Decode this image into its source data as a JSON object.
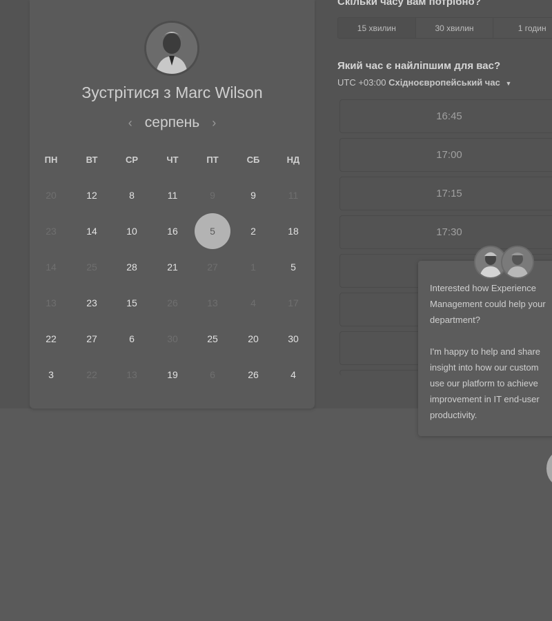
{
  "left": {
    "title": "Зустрітися з Marc Wilson",
    "month": "серпень",
    "prev_icon": "‹",
    "next_icon": "›",
    "weekdays": [
      "ПН",
      "ВТ",
      "СР",
      "ЧТ",
      "ПТ",
      "СБ",
      "НД"
    ],
    "weeks": [
      [
        {
          "t": "20",
          "m": true
        },
        {
          "t": "12",
          "m": false
        },
        {
          "t": "8",
          "m": false
        },
        {
          "t": "11",
          "m": false
        },
        {
          "t": "9",
          "m": true
        },
        {
          "t": "9",
          "m": false
        },
        {
          "t": "11",
          "m": true
        }
      ],
      [
        {
          "t": "23",
          "m": true
        },
        {
          "t": "14",
          "m": false
        },
        {
          "t": "10",
          "m": false
        },
        {
          "t": "16",
          "m": false
        },
        {
          "t": "5",
          "m": false,
          "s": true
        },
        {
          "t": "2",
          "m": false
        },
        {
          "t": "18",
          "m": false
        }
      ],
      [
        {
          "t": "14",
          "m": true
        },
        {
          "t": "25",
          "m": true
        },
        {
          "t": "28",
          "m": false
        },
        {
          "t": "21",
          "m": false
        },
        {
          "t": "27",
          "m": true
        },
        {
          "t": "1",
          "m": true
        },
        {
          "t": "5",
          "m": false
        }
      ],
      [
        {
          "t": "13",
          "m": true
        },
        {
          "t": "23",
          "m": false
        },
        {
          "t": "15",
          "m": false
        },
        {
          "t": "26",
          "m": true
        },
        {
          "t": "13",
          "m": true
        },
        {
          "t": "4",
          "m": true
        },
        {
          "t": "17",
          "m": true
        }
      ],
      [
        {
          "t": "22",
          "m": false
        },
        {
          "t": "27",
          "m": false
        },
        {
          "t": "6",
          "m": false
        },
        {
          "t": "30",
          "m": true
        },
        {
          "t": "25",
          "m": false
        },
        {
          "t": "20",
          "m": false
        },
        {
          "t": "30",
          "m": false
        }
      ],
      [
        {
          "t": "3",
          "m": false
        },
        {
          "t": "22",
          "m": true
        },
        {
          "t": "13",
          "m": true
        },
        {
          "t": "19",
          "m": false
        },
        {
          "t": "6",
          "m": true
        },
        {
          "t": "26",
          "m": false
        },
        {
          "t": "4",
          "m": false
        }
      ]
    ]
  },
  "right": {
    "duration_question": "Скільки часу вам потрібно?",
    "durations": [
      "15 хвилин",
      "30 хвилин",
      "1 годин"
    ],
    "time_question": "Який час є найліпшим для вас?",
    "tz_prefix": "UTC +03:00",
    "tz_name": "Східноєвропейський час",
    "slots": [
      "16:45",
      "17:00",
      "17:15",
      "17:30",
      "",
      "",
      "",
      ""
    ]
  },
  "popup": {
    "lines1": [
      "Interested how Experience",
      "Management could help your",
      "department?"
    ],
    "lines2": [
      "I'm happy to help and share",
      "insight into how our custom",
      "use our platform to achieve",
      "improvement in IT end-user",
      "productivity."
    ]
  }
}
